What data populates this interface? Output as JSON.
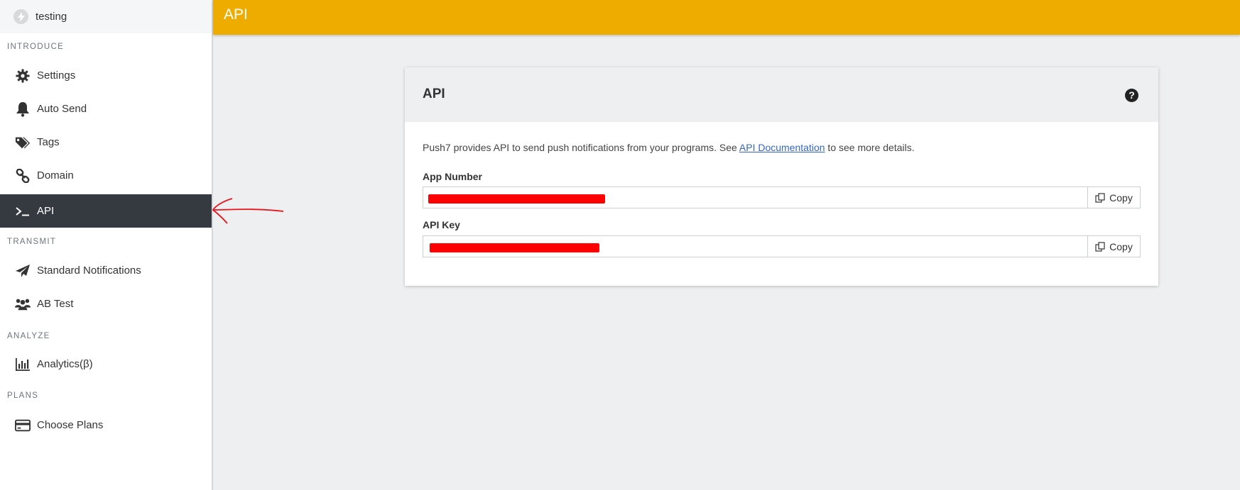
{
  "app": {
    "name": "testing"
  },
  "sidebar": {
    "sections": {
      "introduce": "INTRODUCE",
      "transmit": "TRANSMIT",
      "analyze": "ANALYZE",
      "plans": "PLANS"
    },
    "items": [
      {
        "label": "Settings",
        "icon": "gear-icon"
      },
      {
        "label": "Auto Send",
        "icon": "bell-icon"
      },
      {
        "label": "Tags",
        "icon": "tags-icon"
      },
      {
        "label": "Domain",
        "icon": "link-icon"
      },
      {
        "label": "API",
        "icon": "terminal-icon",
        "active": true
      },
      {
        "label": "Standard Notifications",
        "icon": "paper-plane-icon"
      },
      {
        "label": "AB Test",
        "icon": "users-icon"
      },
      {
        "label": "Analytics(β)",
        "icon": "bar-chart-icon"
      },
      {
        "label": "Choose Plans",
        "icon": "credit-card-icon"
      }
    ]
  },
  "header": {
    "title": "API"
  },
  "card": {
    "title": "API",
    "description_before": "Push7 provides API to send push notifications from your programs. See ",
    "description_link": "API Documentation",
    "description_after": " to see more details.",
    "fields": [
      {
        "label": "App Number",
        "copy_label": "Copy"
      },
      {
        "label": "API Key",
        "copy_label": "Copy"
      }
    ]
  },
  "colors": {
    "header": "#eeac00",
    "sidebar_active": "#343a40",
    "redaction": "#ff0000",
    "link": "#3366cc"
  }
}
